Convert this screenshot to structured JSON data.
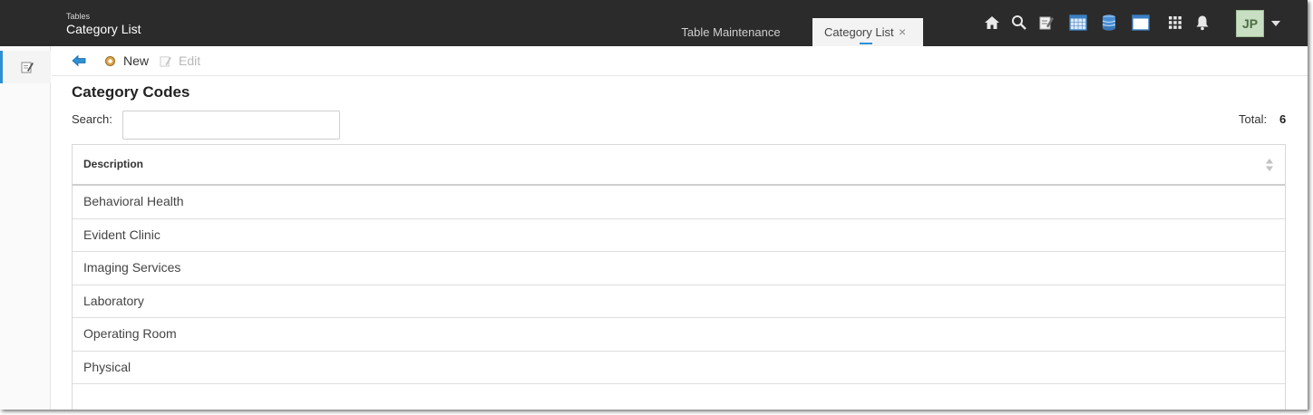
{
  "header": {
    "breadcrumb": "Tables",
    "title": "Category List",
    "tabs": [
      {
        "label": "Table Maintenance",
        "active": false
      },
      {
        "label": "Category List",
        "active": true,
        "close": "×"
      }
    ],
    "icons": [
      "home-icon",
      "search-icon",
      "notes-icon",
      "calendar-grid-icon",
      "database-icon",
      "window-icon",
      "apps-grid-icon",
      "bell-icon"
    ],
    "avatar_initials": "JP"
  },
  "toolbar": {
    "new_label": "New",
    "edit_label": "Edit"
  },
  "main": {
    "heading": "Category Codes",
    "search_label": "Search:",
    "search_value": "",
    "total_label": "Total:",
    "total_value": "6",
    "table": {
      "column_header": "Description",
      "rows": [
        "Behavioral Health",
        "Evident Clinic",
        "Imaging Services",
        "Laboratory",
        "Operating Room",
        "Physical"
      ]
    }
  },
  "colors": {
    "topbar": "#2b2b2b",
    "accent": "#2d8fd5",
    "avatar_bg": "#c9dfc3"
  }
}
